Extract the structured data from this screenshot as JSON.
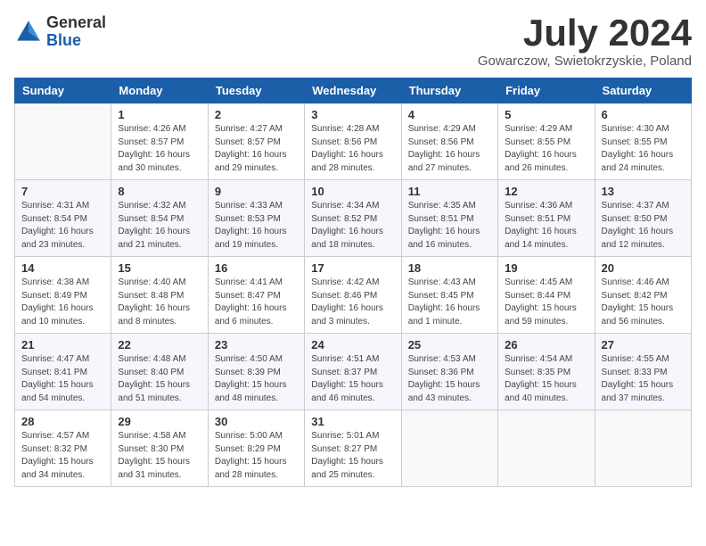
{
  "header": {
    "logo_general": "General",
    "logo_blue": "Blue",
    "month_title": "July 2024",
    "location": "Gowarczow, Swietokrzyskie, Poland"
  },
  "days_of_week": [
    "Sunday",
    "Monday",
    "Tuesday",
    "Wednesday",
    "Thursday",
    "Friday",
    "Saturday"
  ],
  "weeks": [
    [
      {
        "day": "",
        "sunrise": "",
        "sunset": "",
        "daylight": ""
      },
      {
        "day": "1",
        "sunrise": "Sunrise: 4:26 AM",
        "sunset": "Sunset: 8:57 PM",
        "daylight": "Daylight: 16 hours and 30 minutes."
      },
      {
        "day": "2",
        "sunrise": "Sunrise: 4:27 AM",
        "sunset": "Sunset: 8:57 PM",
        "daylight": "Daylight: 16 hours and 29 minutes."
      },
      {
        "day": "3",
        "sunrise": "Sunrise: 4:28 AM",
        "sunset": "Sunset: 8:56 PM",
        "daylight": "Daylight: 16 hours and 28 minutes."
      },
      {
        "day": "4",
        "sunrise": "Sunrise: 4:29 AM",
        "sunset": "Sunset: 8:56 PM",
        "daylight": "Daylight: 16 hours and 27 minutes."
      },
      {
        "day": "5",
        "sunrise": "Sunrise: 4:29 AM",
        "sunset": "Sunset: 8:55 PM",
        "daylight": "Daylight: 16 hours and 26 minutes."
      },
      {
        "day": "6",
        "sunrise": "Sunrise: 4:30 AM",
        "sunset": "Sunset: 8:55 PM",
        "daylight": "Daylight: 16 hours and 24 minutes."
      }
    ],
    [
      {
        "day": "7",
        "sunrise": "Sunrise: 4:31 AM",
        "sunset": "Sunset: 8:54 PM",
        "daylight": "Daylight: 16 hours and 23 minutes."
      },
      {
        "day": "8",
        "sunrise": "Sunrise: 4:32 AM",
        "sunset": "Sunset: 8:54 PM",
        "daylight": "Daylight: 16 hours and 21 minutes."
      },
      {
        "day": "9",
        "sunrise": "Sunrise: 4:33 AM",
        "sunset": "Sunset: 8:53 PM",
        "daylight": "Daylight: 16 hours and 19 minutes."
      },
      {
        "day": "10",
        "sunrise": "Sunrise: 4:34 AM",
        "sunset": "Sunset: 8:52 PM",
        "daylight": "Daylight: 16 hours and 18 minutes."
      },
      {
        "day": "11",
        "sunrise": "Sunrise: 4:35 AM",
        "sunset": "Sunset: 8:51 PM",
        "daylight": "Daylight: 16 hours and 16 minutes."
      },
      {
        "day": "12",
        "sunrise": "Sunrise: 4:36 AM",
        "sunset": "Sunset: 8:51 PM",
        "daylight": "Daylight: 16 hours and 14 minutes."
      },
      {
        "day": "13",
        "sunrise": "Sunrise: 4:37 AM",
        "sunset": "Sunset: 8:50 PM",
        "daylight": "Daylight: 16 hours and 12 minutes."
      }
    ],
    [
      {
        "day": "14",
        "sunrise": "Sunrise: 4:38 AM",
        "sunset": "Sunset: 8:49 PM",
        "daylight": "Daylight: 16 hours and 10 minutes."
      },
      {
        "day": "15",
        "sunrise": "Sunrise: 4:40 AM",
        "sunset": "Sunset: 8:48 PM",
        "daylight": "Daylight: 16 hours and 8 minutes."
      },
      {
        "day": "16",
        "sunrise": "Sunrise: 4:41 AM",
        "sunset": "Sunset: 8:47 PM",
        "daylight": "Daylight: 16 hours and 6 minutes."
      },
      {
        "day": "17",
        "sunrise": "Sunrise: 4:42 AM",
        "sunset": "Sunset: 8:46 PM",
        "daylight": "Daylight: 16 hours and 3 minutes."
      },
      {
        "day": "18",
        "sunrise": "Sunrise: 4:43 AM",
        "sunset": "Sunset: 8:45 PM",
        "daylight": "Daylight: 16 hours and 1 minute."
      },
      {
        "day": "19",
        "sunrise": "Sunrise: 4:45 AM",
        "sunset": "Sunset: 8:44 PM",
        "daylight": "Daylight: 15 hours and 59 minutes."
      },
      {
        "day": "20",
        "sunrise": "Sunrise: 4:46 AM",
        "sunset": "Sunset: 8:42 PM",
        "daylight": "Daylight: 15 hours and 56 minutes."
      }
    ],
    [
      {
        "day": "21",
        "sunrise": "Sunrise: 4:47 AM",
        "sunset": "Sunset: 8:41 PM",
        "daylight": "Daylight: 15 hours and 54 minutes."
      },
      {
        "day": "22",
        "sunrise": "Sunrise: 4:48 AM",
        "sunset": "Sunset: 8:40 PM",
        "daylight": "Daylight: 15 hours and 51 minutes."
      },
      {
        "day": "23",
        "sunrise": "Sunrise: 4:50 AM",
        "sunset": "Sunset: 8:39 PM",
        "daylight": "Daylight: 15 hours and 48 minutes."
      },
      {
        "day": "24",
        "sunrise": "Sunrise: 4:51 AM",
        "sunset": "Sunset: 8:37 PM",
        "daylight": "Daylight: 15 hours and 46 minutes."
      },
      {
        "day": "25",
        "sunrise": "Sunrise: 4:53 AM",
        "sunset": "Sunset: 8:36 PM",
        "daylight": "Daylight: 15 hours and 43 minutes."
      },
      {
        "day": "26",
        "sunrise": "Sunrise: 4:54 AM",
        "sunset": "Sunset: 8:35 PM",
        "daylight": "Daylight: 15 hours and 40 minutes."
      },
      {
        "day": "27",
        "sunrise": "Sunrise: 4:55 AM",
        "sunset": "Sunset: 8:33 PM",
        "daylight": "Daylight: 15 hours and 37 minutes."
      }
    ],
    [
      {
        "day": "28",
        "sunrise": "Sunrise: 4:57 AM",
        "sunset": "Sunset: 8:32 PM",
        "daylight": "Daylight: 15 hours and 34 minutes."
      },
      {
        "day": "29",
        "sunrise": "Sunrise: 4:58 AM",
        "sunset": "Sunset: 8:30 PM",
        "daylight": "Daylight: 15 hours and 31 minutes."
      },
      {
        "day": "30",
        "sunrise": "Sunrise: 5:00 AM",
        "sunset": "Sunset: 8:29 PM",
        "daylight": "Daylight: 15 hours and 28 minutes."
      },
      {
        "day": "31",
        "sunrise": "Sunrise: 5:01 AM",
        "sunset": "Sunset: 8:27 PM",
        "daylight": "Daylight: 15 hours and 25 minutes."
      },
      {
        "day": "",
        "sunrise": "",
        "sunset": "",
        "daylight": ""
      },
      {
        "day": "",
        "sunrise": "",
        "sunset": "",
        "daylight": ""
      },
      {
        "day": "",
        "sunrise": "",
        "sunset": "",
        "daylight": ""
      }
    ]
  ]
}
